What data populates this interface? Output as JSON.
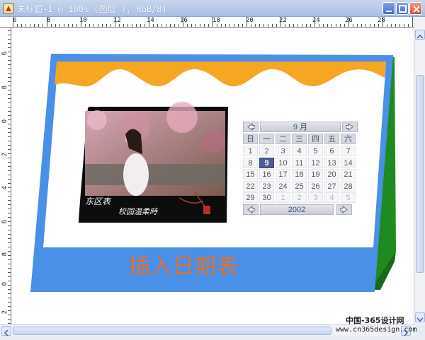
{
  "window": {
    "title": "未标题-1 @ 100% (图层 7, RGB/8)"
  },
  "rulers": {
    "top": [
      "6",
      "8",
      "10",
      "12",
      "14",
      "16",
      "18",
      "20",
      "22",
      "24",
      "26",
      "28"
    ],
    "left": [
      "6",
      "8",
      "0",
      "2",
      "4",
      "6",
      "8",
      "0",
      "2"
    ]
  },
  "artwork": {
    "heading": "插入日期表",
    "photo_caption_left": "东区表",
    "photo_caption_right": "校园温柔時",
    "colors": {
      "frame_blue": "#4a8fe8",
      "wave_orange": "#f5a623",
      "side_green": "#1f8a1f",
      "heading_orange": "#e0712e"
    }
  },
  "calendar": {
    "month": "9 月",
    "year": "2002",
    "weekdays": [
      "日",
      "一",
      "二",
      "三",
      "四",
      "五",
      "六"
    ],
    "weeks": [
      [
        "1",
        "2",
        "3",
        "4",
        "5",
        "6",
        "7"
      ],
      [
        "8",
        "9",
        "10",
        "11",
        "12",
        "13",
        "14"
      ],
      [
        "15",
        "16",
        "17",
        "18",
        "19",
        "20",
        "21"
      ],
      [
        "22",
        "23",
        "24",
        "25",
        "26",
        "27",
        "28"
      ],
      [
        "29",
        "30",
        "1",
        "2",
        "3",
        "4",
        "5"
      ]
    ],
    "selected_day": "9"
  },
  "watermark": {
    "line1": "中国-365设计网",
    "line2": "www.cn365design.com"
  }
}
